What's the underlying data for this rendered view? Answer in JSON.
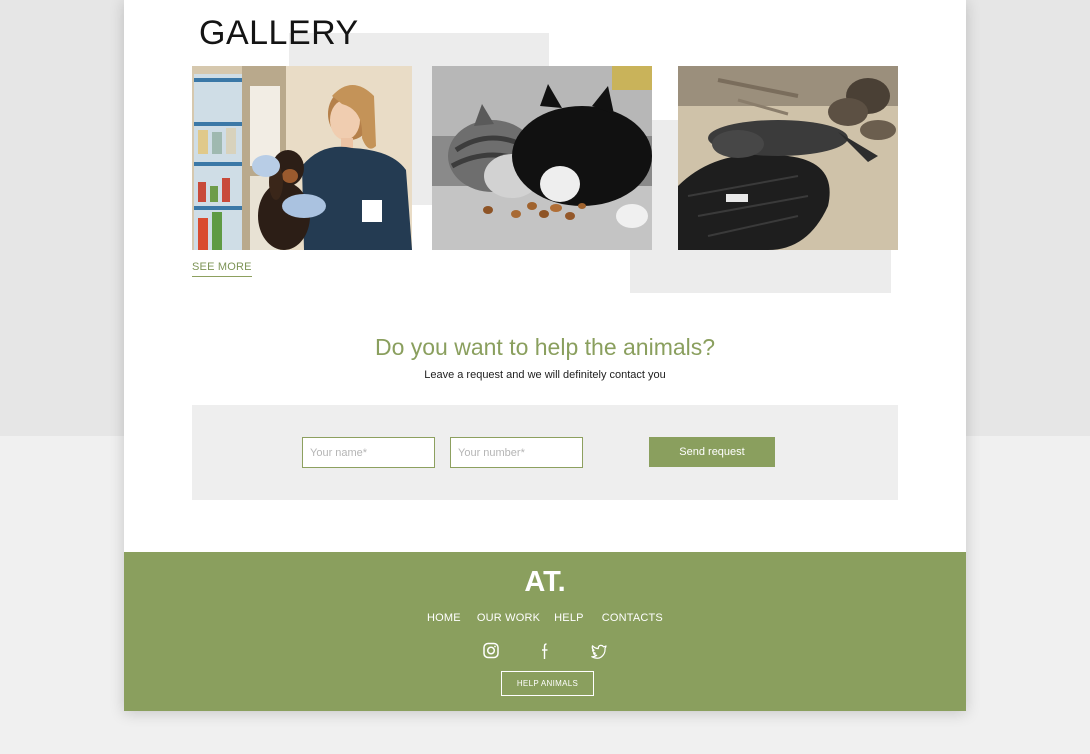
{
  "gallery": {
    "title": "GALLERY",
    "see_more": "SEE MORE",
    "photos": [
      {
        "subject": "veterinarian examining a dachshund"
      },
      {
        "subject": "two cats eating food"
      },
      {
        "subject": "seal lying on a beach"
      }
    ]
  },
  "help": {
    "title": "Do you want to help the animals?",
    "subtitle": "Leave a request and we will definitely contact you",
    "name_placeholder": "Your name*",
    "number_placeholder": "Your number*",
    "send_label": "Send request"
  },
  "footer": {
    "logo": "AT.",
    "nav": [
      "HOME",
      "OUR WORK",
      "HELP",
      "CONTACTS"
    ],
    "social_icons": [
      "instagram-icon",
      "facebook-icon",
      "twitter-icon"
    ],
    "help_button": "HELP ANIMALS"
  },
  "colors": {
    "accent": "#8a9f5e",
    "page_bg": "#e6e6e6",
    "card_bg": "#ffffff",
    "form_panel": "#eeeeee"
  }
}
